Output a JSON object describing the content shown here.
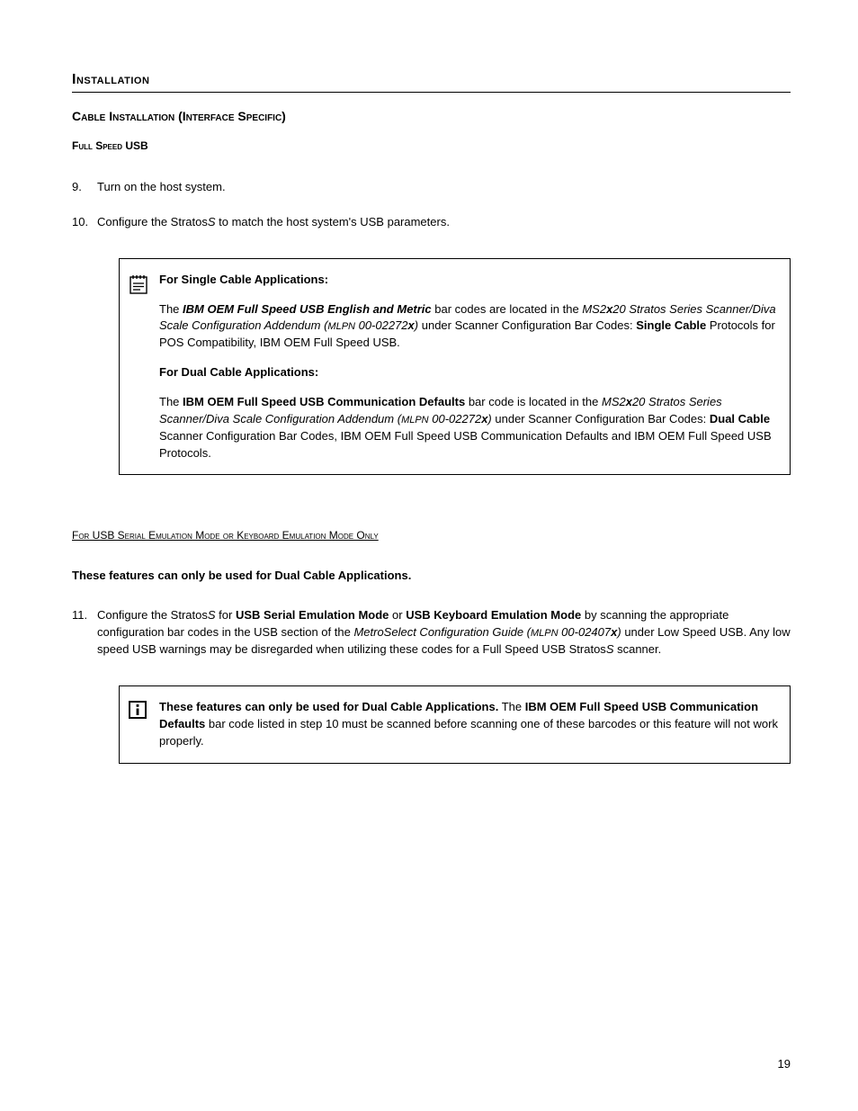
{
  "sectionTitle": "Installation",
  "subsectionTitle": "Cable Installation (Interface Specific)",
  "subsubTitle": "Full Speed USB",
  "step9": {
    "num": "9.",
    "text": "Turn on the host system."
  },
  "step10": {
    "num": "10.",
    "t1": "Configure the Stratos",
    "t2": "S",
    "t3": " to match the host system's USB parameters."
  },
  "callout1": {
    "heading1": "For Single Cable Applications:",
    "p1a": "The ",
    "p1b": "IBM OEM Full Speed USB English and Metric",
    "p1c": " bar codes are located in the ",
    "p1d": "MS2",
    "p1e": "x",
    "p1f": "20 Stratos Series Scanner/Diva Scale Configuration Addendum (",
    "p1g": "MLPN",
    "p1h": "  00-02272",
    "p1i": "x",
    "p1j": ")",
    "p1k": " under Scanner Configuration Bar Codes: ",
    "p1l": "Single Cable",
    "p1m": " Protocols for POS Compatibility, IBM OEM Full Speed USB.",
    "heading2": "For Dual Cable Applications:",
    "p2a": "The ",
    "p2b": "IBM OEM Full Speed USB Communication Defaults",
    "p2c": " bar code is located in the ",
    "p2d": "MS2",
    "p2e": "x",
    "p2f": "20 Stratos Series Scanner/Diva Scale Configuration Addendum (",
    "p2g": "MLPN",
    "p2h": "  00-02272",
    "p2i": "x",
    "p2j": ")",
    "p2k": " under Scanner Configuration Bar Codes: ",
    "p2l": "Dual Cable",
    "p2m": " Scanner Configuration Bar Codes, IBM OEM Full Speed USB Communication Defaults and IBM OEM Full Speed USB Protocols."
  },
  "modeHeading": "For USB Serial Emulation Mode or Keyboard Emulation Mode Only",
  "dualOnlyNote": "These features can only be used for Dual Cable Applications.",
  "step11": {
    "num": "11.",
    "t1": "Configure the Stratos",
    "t2": "S",
    "t3": " for ",
    "t4": "USB Serial Emulation Mode",
    "t5": " or ",
    "t6": "USB Keyboard Emulation Mode",
    "t7": " by scanning the appropriate configuration bar codes in the USB section of the ",
    "t8": "MetroSelect Configuration Guide (",
    "t9": "MLPN",
    "t10": "  00-02407",
    "t11": "x",
    "t12": ")",
    "t13": " under Low Speed USB.  Any low speed USB warnings may be disregarded when utilizing these codes for a Full Speed USB Stratos",
    "t14": "S",
    "t15": " scanner."
  },
  "callout2": {
    "a": "These features can only be used for Dual Cable Applications.",
    "b": "  The ",
    "c": "IBM OEM Full Speed USB Communication Defaults",
    "d": " bar code listed in step 10 must be scanned before scanning one of these barcodes or this feature will not work properly."
  },
  "pageNumber": "19"
}
